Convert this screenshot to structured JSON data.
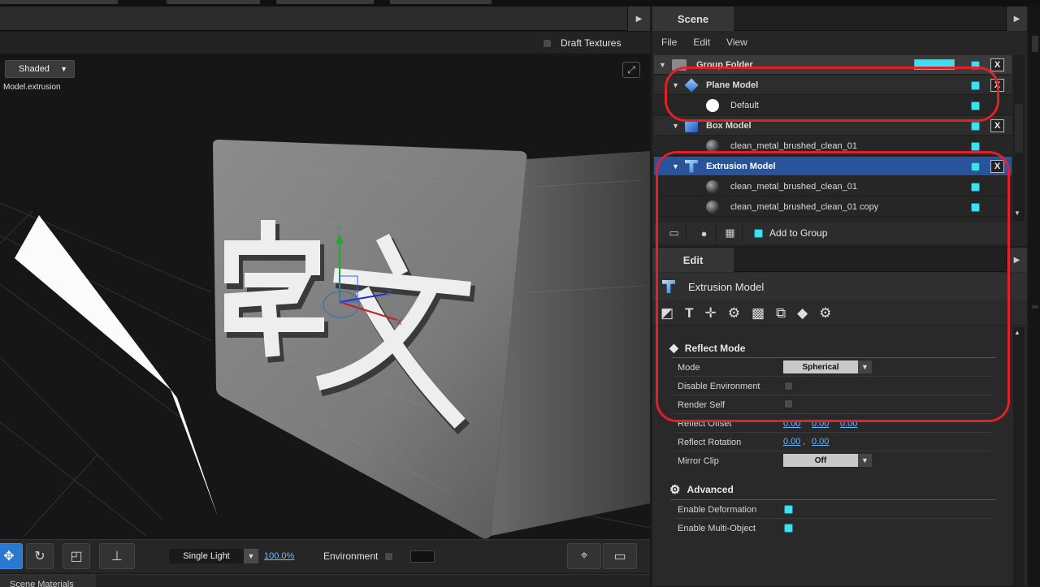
{
  "viewport": {
    "draft_label": "Draft Textures",
    "render_mode": "Shaded",
    "model_name": "Model.extrusion",
    "lighting": "Single Light",
    "zoom": "100.0%",
    "environment_label": "Environment",
    "bottom_tab": "Scene Materials"
  },
  "scene": {
    "tab": "Scene",
    "menu": [
      "File",
      "Edit",
      "View"
    ],
    "rows": [
      {
        "label": "Group Folder",
        "indent": 0
      },
      {
        "label": "Plane Model",
        "indent": 1
      },
      {
        "label": "Default",
        "indent": 2
      },
      {
        "label": "Box Model",
        "indent": 1
      },
      {
        "label": "clean_metal_brushed_clean_01",
        "indent": 2
      },
      {
        "label": "Extrusion Model",
        "indent": 1,
        "selected": true
      },
      {
        "label": "clean_metal_brushed_clean_01",
        "indent": 2
      },
      {
        "label": "clean_metal_brushed_clean_01 copy",
        "indent": 2
      }
    ],
    "add_to_group": "Add to Group"
  },
  "edit": {
    "tab": "Edit",
    "title": "Extrusion Model",
    "reflect_section": "Reflect Mode",
    "mode_label": "Mode",
    "mode_value": "Spherical",
    "disable_env_label": "Disable Environment",
    "render_self_label": "Render Self",
    "reflect_offset_label": "Reflect Offset",
    "reflect_offset": [
      "0.00",
      "0.00",
      "0.00"
    ],
    "reflect_rotation_label": "Reflect Rotation",
    "reflect_rotation": [
      "0.00",
      "0.00"
    ],
    "mirror_clip_label": "Mirror Clip",
    "mirror_clip_value": "Off",
    "advanced_section": "Advanced",
    "enable_deformation_label": "Enable Deformation",
    "enable_multi_label": "Enable Multi-Object"
  },
  "colors": {
    "accent": "#3ce0f0",
    "selection": "#29549c",
    "annotation": "#e0202a",
    "link": "#6fb7ff"
  }
}
